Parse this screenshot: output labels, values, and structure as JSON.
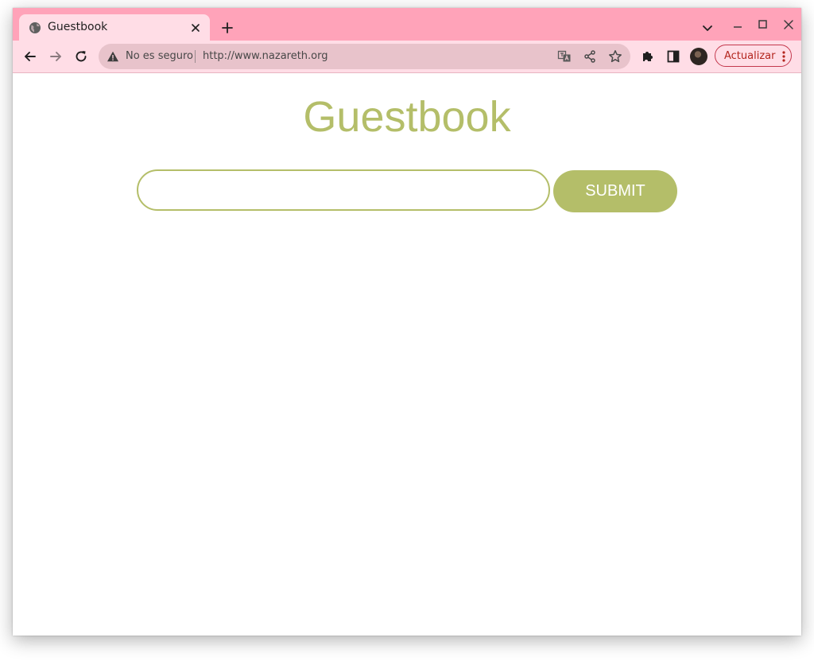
{
  "browser": {
    "tab": {
      "title": "Guestbook"
    },
    "omnibox": {
      "security_label": "No es seguro",
      "url": "http://www.nazareth.org"
    },
    "update_button": {
      "label": "Actualizar"
    },
    "colors": {
      "tabbar": "#ffa3b9",
      "toolbar": "#ffdde6",
      "omnibox": "#e8c3cb",
      "update_accent": "#b3261e"
    },
    "icons": [
      "globe-icon",
      "close-icon",
      "plus-icon",
      "chevron-down-icon",
      "minimize-icon",
      "maximize-icon",
      "back-arrow-icon",
      "forward-arrow-icon",
      "reload-icon",
      "warning-icon",
      "translate-icon",
      "share-icon",
      "star-icon",
      "puzzle-icon",
      "side-panel-icon",
      "kebab-menu-icon"
    ]
  },
  "page": {
    "heading": "Guestbook",
    "input": {
      "value": "",
      "placeholder": ""
    },
    "submit_label": "SUBMIT",
    "colors": {
      "accent": "#b4be69",
      "background": "#ffffff"
    }
  }
}
